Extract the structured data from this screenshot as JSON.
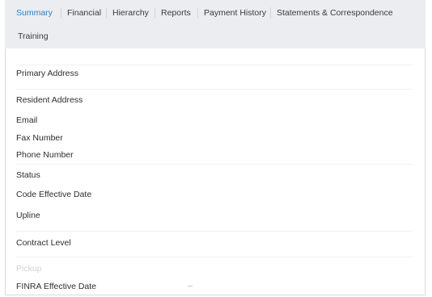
{
  "tabs": {
    "summary": "Summary",
    "financial": "Financial",
    "hierarchy": "Hierarchy",
    "reports": "Reports",
    "payment_history": "Payment History",
    "statements": "Statements & Correspondence",
    "training": "Training"
  },
  "fields": {
    "primary_address": "Primary Address",
    "resident_address": "Resident Address",
    "email": "Email",
    "fax_number": "Fax Number",
    "phone_number": "Phone Number",
    "status": "Status",
    "code_effective_date": "Code Effective Date",
    "upline": "Upline",
    "contract_level": "Contract Level",
    "faded_label": "Pickup",
    "finra_effective_date": "FINRA Effective Date"
  },
  "colors": {
    "active_tab": "#2f80c6",
    "tabbar_bg": "#ebedf0"
  }
}
